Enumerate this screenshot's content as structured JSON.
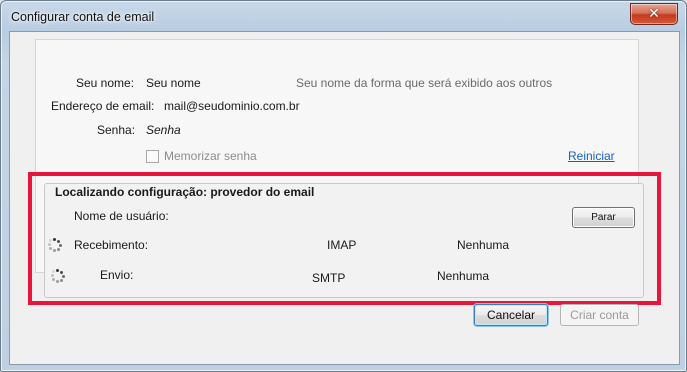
{
  "window": {
    "title": "Configurar conta de email",
    "close_symbol": "✕"
  },
  "form": {
    "name_label": "Seu nome:",
    "name_value": "Seu nome",
    "name_hint": "Seu nome da forma que será exibido aos outros",
    "email_label": "Endereço de email:",
    "email_value": "mail@seudominio.com.br",
    "password_label": "Senha:",
    "password_value": "Senha",
    "remember_label": "Memorizar senha",
    "reset_link": "Reiniciar"
  },
  "config": {
    "heading": "Localizando configuração: provedor do email",
    "username_label": "Nome de usuário:",
    "stop_button": "Parar",
    "incoming_label": "Recebimento:",
    "incoming_protocol": "IMAP",
    "incoming_security": "Nenhuma",
    "outgoing_label": "Envio:",
    "outgoing_protocol": "SMTP",
    "outgoing_security": "Nenhuma"
  },
  "buttons": {
    "cancel": "Cancelar",
    "create": "Criar conta"
  },
  "colors": {
    "highlight": "#e8143b",
    "link": "#1b5fc5"
  },
  "icons": {
    "loading": "spinner-icon",
    "close": "close-icon"
  }
}
